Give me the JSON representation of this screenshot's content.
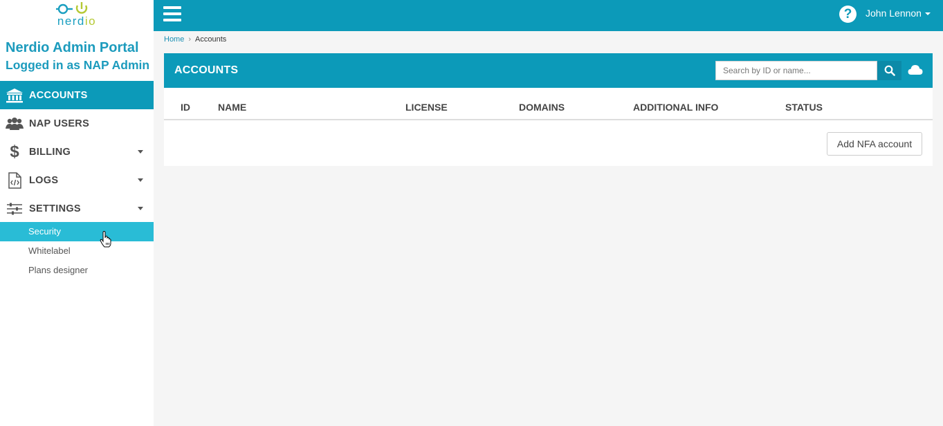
{
  "logo": {
    "text_main": "nerd",
    "text_accent": "io"
  },
  "portal": {
    "title": "Nerdio Admin Portal",
    "subtitle": "Logged in as NAP Admin"
  },
  "nav": {
    "accounts": "ACCOUNTS",
    "nap_users": "NAP USERS",
    "billing": "BILLING",
    "logs": "LOGS",
    "settings": "SETTINGS",
    "settings_sub": {
      "security": "Security",
      "whitelabel": "Whitelabel",
      "plans_designer": "Plans designer"
    }
  },
  "topbar": {
    "help": "?",
    "user": "John Lennon"
  },
  "breadcrumb": {
    "home": "Home",
    "current": "Accounts"
  },
  "panel": {
    "title": "ACCOUNTS",
    "search_placeholder": "Search by ID or name...",
    "columns": [
      "ID",
      "NAME",
      "LICENSE",
      "DOMAINS",
      "ADDITIONAL INFO",
      "STATUS"
    ],
    "add_button": "Add NFA account"
  },
  "colors": {
    "accent": "#0c9ab9",
    "active_sub": "#29bcd6",
    "brand_green": "#b5c934"
  }
}
